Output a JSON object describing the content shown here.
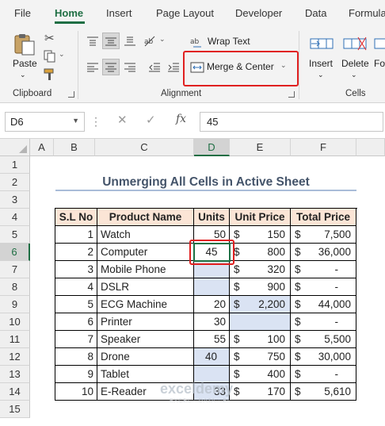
{
  "ribbon_tabs": [
    "File",
    "Home",
    "Insert",
    "Page Layout",
    "Developer",
    "Data",
    "Formula"
  ],
  "clipboard": {
    "paste_label": "Paste",
    "group_label": "Clipboard"
  },
  "alignment": {
    "wrap_text_label": "Wrap Text",
    "merge_center_label": "Merge & Center",
    "group_label": "Alignment"
  },
  "cells_group": {
    "insert_label": "Insert",
    "delete_label": "Delete",
    "format_label": "Fo",
    "group_label": "Cells"
  },
  "formula_bar": {
    "name_box": "D6",
    "fx_label": "fx",
    "value": "45"
  },
  "columns": [
    "A",
    "B",
    "C",
    "D",
    "E",
    "F"
  ],
  "rows": [
    "1",
    "2",
    "3",
    "4",
    "5",
    "6",
    "7",
    "8",
    "9",
    "10",
    "11",
    "12",
    "13",
    "14",
    "15"
  ],
  "sheet_title": "Unmerging All Cells in Active Sheet",
  "table": {
    "headers": [
      "S.L No",
      "Product Name",
      "Units",
      "Unit Price",
      "Total Price"
    ],
    "rows": [
      {
        "sl": "1",
        "name": "Watch",
        "units": "50",
        "price_sym": "$",
        "price": "150",
        "total_sym": "$",
        "total": "7,500"
      },
      {
        "sl": "2",
        "name": "Computer",
        "units": "45",
        "price_sym": "$",
        "price": "800",
        "total_sym": "$",
        "total": "36,000"
      },
      {
        "sl": "3",
        "name": "Mobile Phone",
        "units": "",
        "price_sym": "$",
        "price": "320",
        "total_sym": "$",
        "total": "-"
      },
      {
        "sl": "4",
        "name": "DSLR",
        "units": "",
        "price_sym": "$",
        "price": "900",
        "total_sym": "$",
        "total": "-"
      },
      {
        "sl": "5",
        "name": "ECG Machine",
        "units": "20",
        "price_sym": "$",
        "price": "2,200",
        "total_sym": "$",
        "total": "44,000"
      },
      {
        "sl": "6",
        "name": "Printer",
        "units": "30",
        "price_sym": "",
        "price": "",
        "total_sym": "$",
        "total": "-"
      },
      {
        "sl": "7",
        "name": "Speaker",
        "units": "55",
        "price_sym": "$",
        "price": "100",
        "total_sym": "$",
        "total": "5,500"
      },
      {
        "sl": "8",
        "name": "Drone",
        "units": "40",
        "price_sym": "$",
        "price": "750",
        "total_sym": "$",
        "total": "30,000"
      },
      {
        "sl": "9",
        "name": "Tablet",
        "units": "",
        "price_sym": "$",
        "price": "400",
        "total_sym": "$",
        "total": "-"
      },
      {
        "sl": "10",
        "name": "E-Reader",
        "units": "33",
        "price_sym": "$",
        "price": "170",
        "total_sym": "$",
        "total": "5,610"
      }
    ]
  },
  "watermark": {
    "brand": "exceldemy",
    "tagline": "EXCEL · DATA · BI"
  },
  "colors": {
    "accent": "#1e6e43",
    "header_fill": "#fbe5d6",
    "blank_fill": "#dae3f3",
    "highlight": "#e02020",
    "title_color": "#44546a"
  }
}
